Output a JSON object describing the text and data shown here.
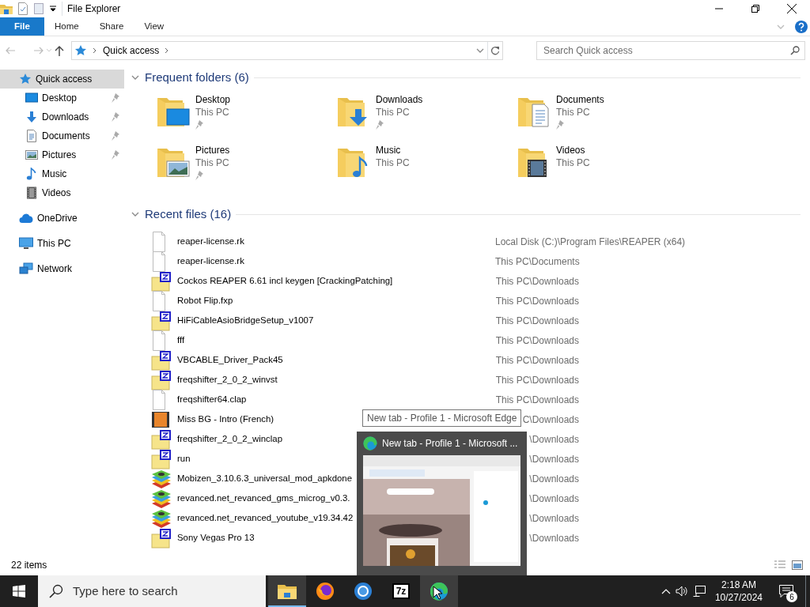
{
  "window": {
    "title": "File Explorer"
  },
  "ribbon": {
    "tabs": [
      {
        "label": "File",
        "kind": "menu"
      },
      {
        "label": "Home",
        "kind": "tab"
      },
      {
        "label": "Share",
        "kind": "tab"
      },
      {
        "label": "View",
        "kind": "tab"
      }
    ]
  },
  "address": {
    "path": [
      "Quick access"
    ],
    "search_placeholder": "Search Quick access"
  },
  "sidebar": {
    "items": [
      {
        "label": "Quick access",
        "kind": "star",
        "selected": true,
        "children": [
          {
            "label": "Desktop",
            "kind": "desktop",
            "pinned": true
          },
          {
            "label": "Downloads",
            "kind": "downloads",
            "pinned": true
          },
          {
            "label": "Documents",
            "kind": "documents",
            "pinned": true
          },
          {
            "label": "Pictures",
            "kind": "pictures",
            "pinned": true
          },
          {
            "label": "Music",
            "kind": "music",
            "pinned": false
          },
          {
            "label": "Videos",
            "kind": "videos",
            "pinned": false
          }
        ]
      },
      {
        "label": "OneDrive",
        "kind": "cloud",
        "selected": false
      },
      {
        "label": "This PC",
        "kind": "pc",
        "selected": false
      },
      {
        "label": "Network",
        "kind": "network",
        "selected": false
      }
    ]
  },
  "frequent_folders": {
    "title": "Frequent folders (6)",
    "expanded": true,
    "items": [
      {
        "name": "Desktop",
        "location": "This PC",
        "kind": "desktop",
        "pinned": true
      },
      {
        "name": "Downloads",
        "location": "This PC",
        "kind": "downloads",
        "pinned": true
      },
      {
        "name": "Documents",
        "location": "This PC",
        "kind": "documents",
        "pinned": true
      },
      {
        "name": "Pictures",
        "location": "This PC",
        "kind": "pictures",
        "pinned": true
      },
      {
        "name": "Music",
        "location": "This PC",
        "kind": "music",
        "pinned": false
      },
      {
        "name": "Videos",
        "location": "This PC",
        "kind": "videos",
        "pinned": false
      }
    ]
  },
  "recent_files": {
    "title": "Recent files (16)",
    "expanded": true,
    "rows": [
      {
        "name": "reaper-license.rk",
        "location": "Local Disk (C:)\\Program Files\\REAPER (x64)",
        "kind": "blank"
      },
      {
        "name": "reaper-license.rk",
        "location": "This PC\\Documents",
        "kind": "blank"
      },
      {
        "name": "Cockos REAPER 6.61 incl keygen [CrackingPatching]",
        "location": "This PC\\Downloads",
        "kind": "archive"
      },
      {
        "name": "Robot Flip.fxp",
        "location": "This PC\\Downloads",
        "kind": "blank"
      },
      {
        "name": "HiFiCableAsioBridgeSetup_v1007",
        "location": "This PC\\Downloads",
        "kind": "archive"
      },
      {
        "name": "fff",
        "location": "This PC\\Downloads",
        "kind": "blank"
      },
      {
        "name": "VBCABLE_Driver_Pack45",
        "location": "This PC\\Downloads",
        "kind": "archive"
      },
      {
        "name": "freqshifter_2_0_2_winvst",
        "location": "This PC\\Downloads",
        "kind": "archive"
      },
      {
        "name": "freqshifter64.clap",
        "location": "This PC\\Downloads",
        "kind": "blank"
      },
      {
        "name": "Miss BG - Intro (French)",
        "location": "C\\Downloads",
        "kind": "video"
      },
      {
        "name": "freqshifter_2_0_2_winclap",
        "location": "\\Downloads",
        "kind": "archive"
      },
      {
        "name": "run",
        "location": "\\Downloads",
        "kind": "archive"
      },
      {
        "name": "Mobizen_3.10.6.3_universal_mod_apkdone",
        "location": "\\Downloads",
        "kind": "stack"
      },
      {
        "name": "revanced.net_revanced_gms_microg_v0.3.",
        "location": "\\Downloads",
        "kind": "stack"
      },
      {
        "name": "revanced.net_revanced_youtube_v19.34.42",
        "location": "\\Downloads",
        "kind": "stack"
      },
      {
        "name": "Sony Vegas Pro 13",
        "location": "\\Downloads",
        "kind": "archive"
      }
    ]
  },
  "status_bar": {
    "item_count": "22 items"
  },
  "tooltip": {
    "text": "New tab - Profile 1 - Microsoft Edge"
  },
  "thumbnail": {
    "title": "New tab - Profile 1 - Microsoft ..."
  },
  "taskbar": {
    "search_placeholder": "Type here to search",
    "apps": [
      {
        "kind": "folder",
        "active": true,
        "hovered": false
      },
      {
        "kind": "firefox",
        "active": false,
        "hovered": false
      },
      {
        "kind": "chrome",
        "active": false,
        "hovered": false
      },
      {
        "kind": "label",
        "label": "7z",
        "active": false,
        "hovered": false
      },
      {
        "kind": "edge",
        "active": false,
        "hovered": true
      }
    ],
    "clock": {
      "time": "2:18 AM",
      "date": "10/27/2024"
    },
    "notifications": "6"
  }
}
